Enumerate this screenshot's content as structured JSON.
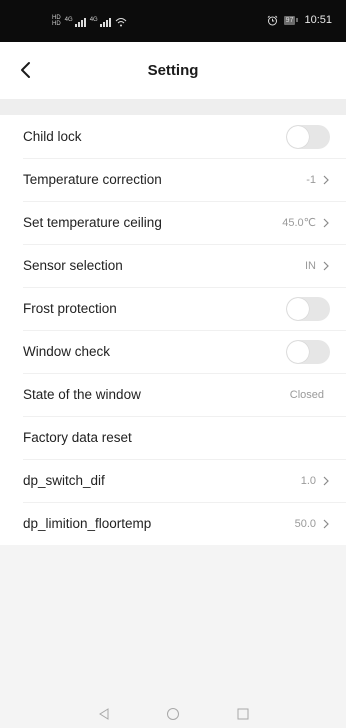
{
  "status_bar": {
    "time": "10:51",
    "battery": "97",
    "signal1_label": "4G",
    "signal2_label": "4G"
  },
  "header": {
    "title": "Setting"
  },
  "settings": {
    "child_lock": {
      "label": "Child lock",
      "enabled": false
    },
    "temperature_correction": {
      "label": "Temperature correction",
      "value": "-1"
    },
    "temperature_ceiling": {
      "label": "Set temperature ceiling",
      "value": "45.0℃"
    },
    "sensor_selection": {
      "label": "Sensor selection",
      "value": "IN"
    },
    "frost_protection": {
      "label": "Frost protection",
      "enabled": false
    },
    "window_check": {
      "label": "Window check",
      "enabled": false
    },
    "window_state": {
      "label": "State of the window",
      "value": "Closed"
    },
    "factory_reset": {
      "label": "Factory data reset"
    },
    "dp_switch_dif": {
      "label": "dp_switch_dif",
      "value": "1.0"
    },
    "dp_limition_floortemp": {
      "label": "dp_limition_floortemp",
      "value": "50.0"
    }
  },
  "icons": {
    "back": "chevron-left-icon",
    "arrow": "chevron-right-icon",
    "alarm": "alarm-clock-icon",
    "nav_back": "triangle-back-icon",
    "nav_home": "circle-home-icon",
    "nav_recent": "square-recent-icon"
  },
  "colors": {
    "status_bar_bg": "#0c0c0c",
    "toggle_off": "#e6e6e6",
    "value_text": "#9a9a9a",
    "page_bg": "#f4f4f4"
  }
}
